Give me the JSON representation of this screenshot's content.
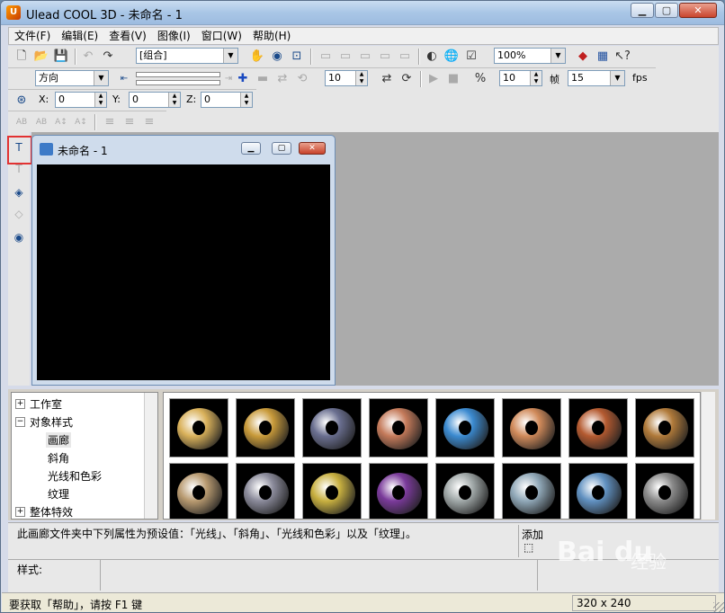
{
  "window": {
    "title": "Ulead COOL 3D - 未命名 - 1"
  },
  "menu": [
    "文件(F)",
    "编辑(E)",
    "查看(V)",
    "图像(I)",
    "窗口(W)",
    "帮助(H)"
  ],
  "toolbar": {
    "group_combo": "[组合]",
    "zoom_combo": "100%",
    "direction_combo": "方向",
    "step_value": "10",
    "frame_value": "10",
    "frame_label": "帧",
    "fps_combo": "15",
    "fps_label": "fps",
    "x_label": "X:",
    "x_value": "0",
    "y_label": "Y:",
    "y_value": "0",
    "z_label": "Z:",
    "z_value": "0"
  },
  "document": {
    "title": "未命名 - 1"
  },
  "tree": [
    {
      "label": "工作室",
      "expander": "+"
    },
    {
      "label": "对象样式",
      "expander": "−"
    },
    {
      "label": "画廊"
    },
    {
      "label": "斜角"
    },
    {
      "label": "光线和色彩"
    },
    {
      "label": "纹理"
    },
    {
      "label": "整体特效",
      "expander": "+"
    }
  ],
  "description": "此画廊文件夹中下列属性为预设值：「光线」、「斜角」、「光线和色彩」以及「纹理」。",
  "add_label": "添加",
  "style_label": "样式:",
  "status": {
    "hint": "要获取「帮助」，请按 F1 键",
    "size": "320 x 240"
  },
  "watermark": {
    "brand": "Bai du",
    "sub": "经验"
  },
  "thumb_colors": [
    "#d9b15a",
    "#c89a3a",
    "#6a6f90",
    "#c47a5a",
    "#3b8ad0",
    "#d08a5a",
    "#b45a30",
    "#b07a3a",
    "#b89a70",
    "#8a8a9a",
    "#c8b040",
    "#7a3a9a",
    "#a0a8a8",
    "#90a8b8",
    "#6090c0",
    "#8a8a8a"
  ]
}
